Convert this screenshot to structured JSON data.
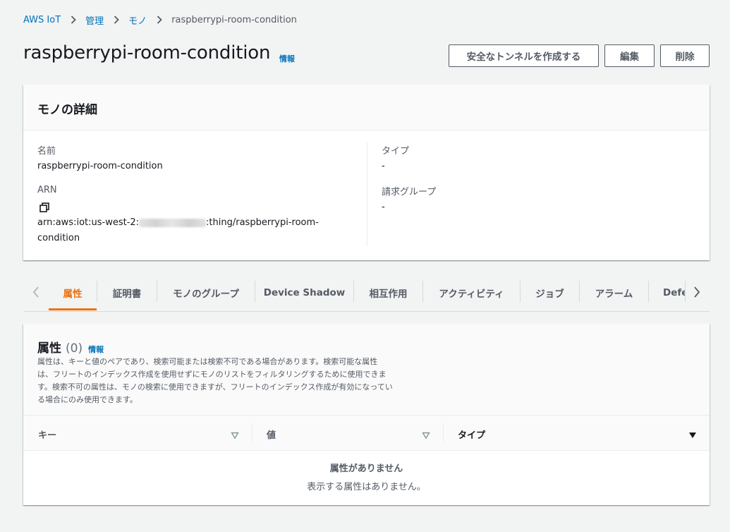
{
  "breadcrumb": {
    "items": [
      "AWS IoT",
      "管理",
      "モノ"
    ],
    "current": "raspberrypi-room-condition"
  },
  "header": {
    "title": "raspberrypi-room-condition",
    "info": "情報",
    "buttons": {
      "tunnel": "安全なトンネルを作成する",
      "edit": "編集",
      "delete": "削除"
    }
  },
  "details": {
    "heading": "モノの詳細",
    "name_label": "名前",
    "name_value": "raspberrypi-room-condition",
    "arn_label": "ARN",
    "arn_prefix": "arn:aws:iot:us-west-2:",
    "arn_suffix": ":thing/raspberrypi-room-",
    "arn_line2": "condition",
    "type_label": "タイプ",
    "type_value": "-",
    "billing_label": "請求グループ",
    "billing_value": "-"
  },
  "tabs": [
    "属性",
    "証明書",
    "モノのグループ",
    "Device Shadow",
    "相互作用",
    "アクティビティ",
    "ジョブ",
    "アラーム",
    "Defe"
  ],
  "attributes": {
    "heading": "属性",
    "count": "(0)",
    "info": "情報",
    "description": [
      "属性は、キーと値のペアであり、検索可能または検索不可である場合があります。検索可能な属性",
      "は、フリートのインデックス作成を使用せずにモノのリストをフィルタリングするために使用できま",
      "す。検索不可の属性は、モノの検索に使用できますが、フリートのインデックス作成が有効になってい",
      "る場合にのみ使用できます。"
    ],
    "columns": [
      "キー",
      "値",
      "タイプ"
    ],
    "empty_title": "属性がありません",
    "empty_text": "表示する属性はありません。"
  },
  "colors": {
    "link": "#0073bb",
    "accent": "#ec7211",
    "background": "#f2f3f3"
  }
}
